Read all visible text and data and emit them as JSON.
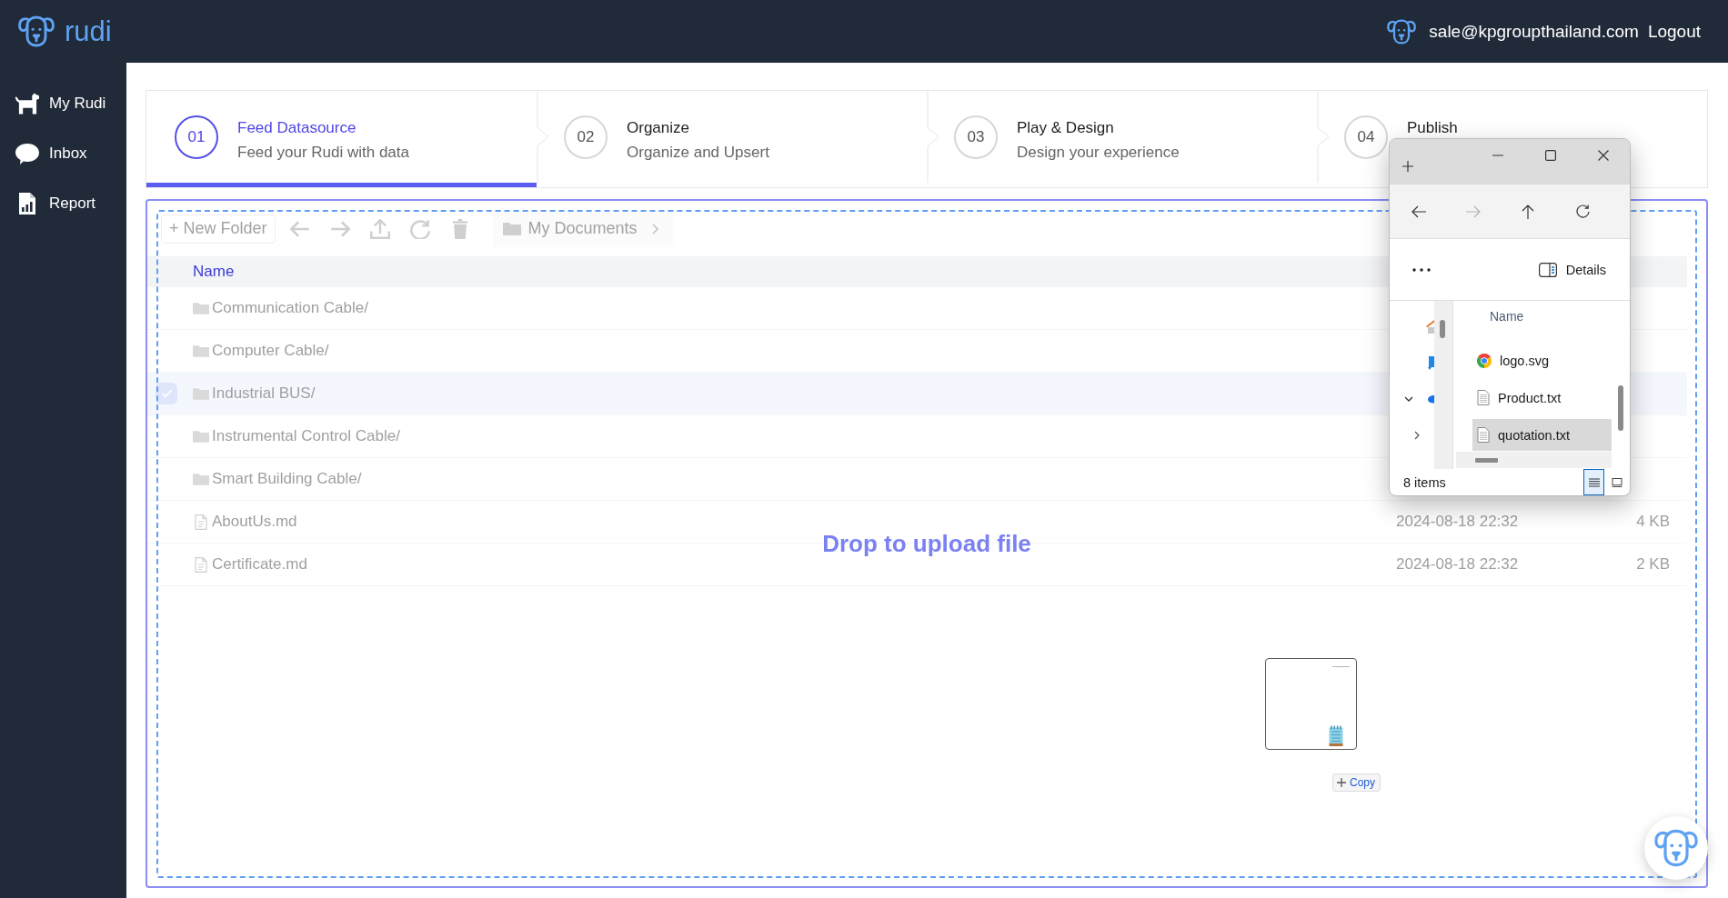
{
  "header": {
    "app_name": "rudi",
    "user_email": "sale@kpgroupthailand.com",
    "logout": "Logout"
  },
  "sidebar": {
    "items": [
      {
        "kind": "dog",
        "label": "My Rudi",
        "selected": false
      },
      {
        "kind": "chat",
        "label": "Inbox",
        "selected": false
      },
      {
        "kind": "report",
        "label": "Report",
        "selected": false
      }
    ]
  },
  "stepper": {
    "steps": [
      {
        "number": "01",
        "title": "Feed Datasource",
        "subtitle": "Feed your Rudi with data",
        "selected": true
      },
      {
        "number": "02",
        "title": "Organize",
        "subtitle": "Organize and Upsert",
        "selected": false
      },
      {
        "number": "03",
        "title": "Play & Design",
        "subtitle": "Design your experience",
        "selected": false
      },
      {
        "number": "04",
        "title": "Publish",
        "selected": false
      }
    ]
  },
  "file_manager": {
    "new_folder": "+ New Folder",
    "breadcrumb": "My Documents",
    "columns": [
      "Name"
    ],
    "rows": [
      {
        "kind": "folder",
        "name": "Communication Cable/",
        "selected": false
      },
      {
        "kind": "folder",
        "name": "Computer Cable/",
        "selected": false
      },
      {
        "kind": "folder",
        "name": "Industrial BUS/",
        "selected": true
      },
      {
        "kind": "folder",
        "name": "Instrumental Control Cable/",
        "selected": false
      },
      {
        "kind": "folder",
        "name": "Smart Building Cable/",
        "selected": false
      },
      {
        "kind": "file",
        "name": "AboutUs.md",
        "modified": "2024-08-18 22:32",
        "size": "4 KB",
        "selected": false
      },
      {
        "kind": "file",
        "name": "Certificate.md",
        "modified": "2024-08-18 22:32",
        "size": "2 KB",
        "selected": false
      }
    ],
    "drop_message": "Drop to upload file"
  },
  "drag_preview": {
    "badge": "Copy"
  },
  "explorer_window": {
    "nav_buttons": [
      {
        "kind": "back",
        "disabled": false
      },
      {
        "kind": "forward",
        "disabled": true
      },
      {
        "kind": "up",
        "disabled": false
      },
      {
        "kind": "refresh",
        "disabled": false
      }
    ],
    "details": "Details",
    "nav_pane": [
      {
        "kind": "home"
      },
      {
        "kind": "desktop"
      },
      {
        "kind": "cloud",
        "expanded": true,
        "children": [
          {
            "expanded": false
          }
        ]
      }
    ],
    "column": "Name",
    "files": [
      {
        "kind": "chrome",
        "name": "logo.svg",
        "selected": false
      },
      {
        "kind": "text",
        "name": "Product.txt",
        "selected": false
      },
      {
        "kind": "text",
        "name": "quotation.txt",
        "selected": true
      }
    ],
    "status": "8 items",
    "views": [
      {
        "kind": "details",
        "selected": true
      },
      {
        "kind": "tiles",
        "selected": false
      }
    ]
  }
}
